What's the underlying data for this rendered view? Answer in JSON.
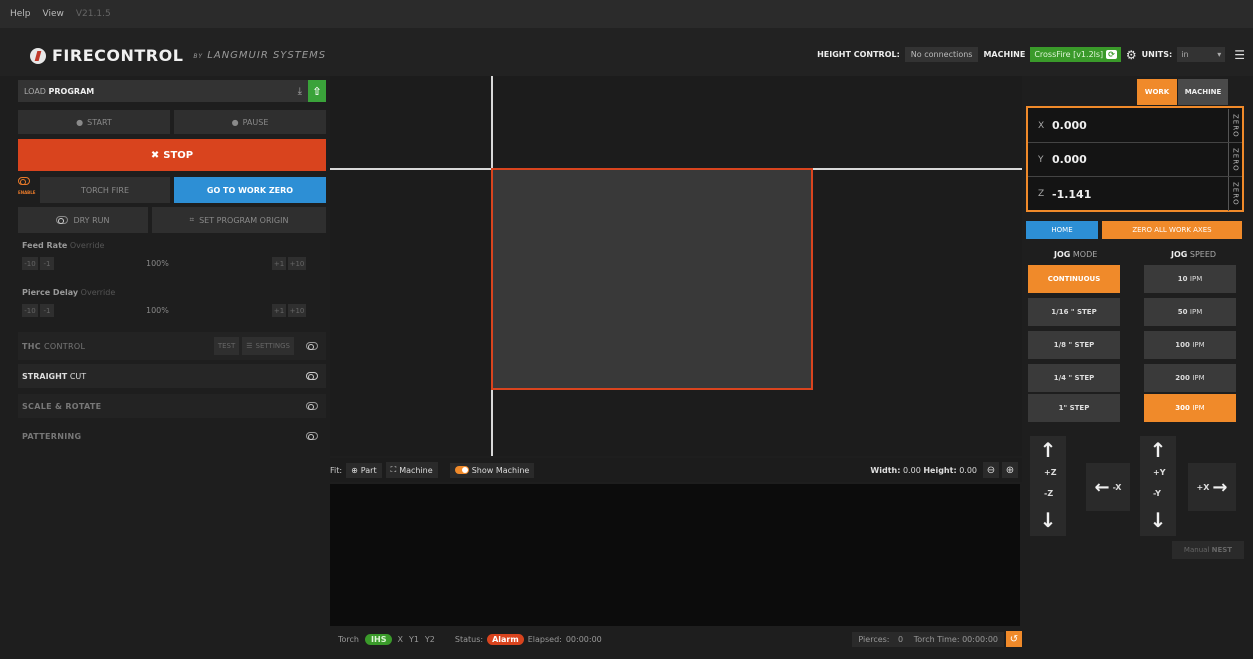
{
  "menu": {
    "help": "Help",
    "view": "View",
    "version": "V21.1.5"
  },
  "brand": {
    "name": "FIRECONTROL",
    "byline": "BY",
    "maker": "LANGMUIR SYSTEMS"
  },
  "header": {
    "height_control_label": "HEIGHT CONTROL:",
    "height_control_value": "No connections",
    "machine_label": "MACHINE",
    "machine_value": "CrossFire [v1.2ls]",
    "units_label": "UNITS:",
    "units_value": "in"
  },
  "left": {
    "load_label": "LOAD",
    "load_bold": "PROGRAM",
    "start": "START",
    "pause": "PAUSE",
    "stop": "STOP",
    "enable": "ENABLE",
    "torch_fire": "TORCH FIRE",
    "go_to_work_zero": "GO TO WORK ZERO",
    "dry_run": "DRY RUN",
    "set_program_origin": "SET PROGRAM ORIGIN",
    "feed_rate": {
      "title": "Feed Rate",
      "sub": "Override",
      "m10": "-10",
      "m1": "-1",
      "value": "100%",
      "p1": "+1",
      "p10": "+10"
    },
    "pierce_delay": {
      "title": "Pierce Delay",
      "sub": "Override",
      "m10": "-10",
      "m1": "-1",
      "value": "100%",
      "p1": "+1",
      "p10": "+10"
    },
    "thc": {
      "bold": "THC",
      "rest": "CONTROL",
      "test": "TEST",
      "settings": "SETTINGS"
    },
    "straight": {
      "bold": "STRAIGHT",
      "rest": "CUT"
    },
    "scale_rotate": "SCALE & ROTATE",
    "patterning": "PATTERNING"
  },
  "fitbar": {
    "fit": "Fit:",
    "part": "Part",
    "machine": "Machine",
    "show_machine": "Show Machine",
    "width_label": "Width:",
    "width_value": "0.00",
    "height_label": "Height:",
    "height_value": "0.00"
  },
  "status": {
    "torch": "Torch",
    "ihs": "IHS",
    "x": "X",
    "y1": "Y1",
    "y2": "Y2",
    "status_label": "Status:",
    "status_value": "Alarm",
    "elapsed_label": "Elapsed:",
    "elapsed_value": "00:00:00",
    "pierces_label": "Pierces:",
    "pierces_value": "0",
    "torch_time_label": "Torch Time:",
    "torch_time_value": "00:00:00"
  },
  "right": {
    "tab_work": "WORK",
    "tab_machine": "MACHINE",
    "coords": [
      {
        "axis": "X",
        "value": "0.000",
        "zero": "ZERO"
      },
      {
        "axis": "Y",
        "value": "0.000",
        "zero": "ZERO"
      },
      {
        "axis": "Z",
        "value": "-1.141",
        "zero": "ZERO"
      }
    ],
    "home": "HOME",
    "zero_all": "ZERO ALL WORK AXES",
    "jog_mode": {
      "bold": "JOG",
      "rest": "MODE"
    },
    "jog_speed": {
      "bold": "JOG",
      "rest": "SPEED"
    },
    "modes": [
      "CONTINUOUS",
      "1/16 \" STEP",
      "1/8 \" STEP",
      "1/4 \" STEP",
      "1\" STEP"
    ],
    "speeds": [
      {
        "num": "10",
        "unit": "IPM"
      },
      {
        "num": "50",
        "unit": "IPM"
      },
      {
        "num": "100",
        "unit": "IPM"
      },
      {
        "num": "200",
        "unit": "IPM"
      },
      {
        "num": "300",
        "unit": "IPM"
      }
    ],
    "pz": "+Z",
    "mz": "-Z",
    "mx": "-X",
    "py": "+Y",
    "my": "-Y",
    "px": "+X",
    "manual": "Manual",
    "nest": "NEST"
  },
  "colors": {
    "accent_orange": "#f08a2a",
    "stop_red": "#d9441e",
    "blue": "#2d8fd5",
    "green": "#3a9a2a"
  }
}
